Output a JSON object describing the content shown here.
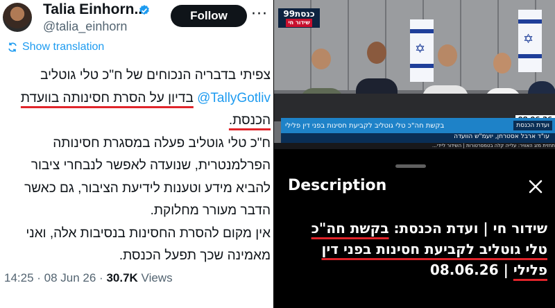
{
  "tweet": {
    "author_name": "Talia Einhorn...",
    "handle": "@talia_einhorn",
    "follow_label": "Follow",
    "more_glyph": "···",
    "show_translation": "Show translation",
    "p1_a": "צפיתי בדבריה הנכוחים של ח\"כ טלי גוטליב ",
    "mention": "@TallyGotliv",
    "p1_b": " ",
    "p1_ul": "בדיון על הסרת חסינותה בוועדת הכנסת.",
    "p2": "ח\"כ טלי גוטליב פעלה במסגרת חסינותה הפרלמנטרית, שנועדה לאפשר לנבחרי ציבור להביא מידע וטענות לידיעת הציבור, גם כאשר הדבר מעורר מחלוקת.",
    "p3": "אין מקום להסרת החסינות בנסיבות אלה, ואני מאמינה שכך תפעל הכנסת.",
    "time": "14:25 · 08 Jun 26 · ",
    "views_count": "30.7K",
    "views_label": " Views"
  },
  "video": {
    "logo_text": "כנסת99",
    "logo_sub": "שידור חי",
    "ticker_tag": "ועדת הכנסת",
    "ticker_main": "בקשת חה\"כ טלי גוטליב לקביעת חסינות בפני דין פלילי",
    "ticker_sub": "עו\"ד ארבל אסטרחן, יועמ\"ש הוועדה",
    "date": "08.06.26",
    "ticker_bottom": "תחזית מזג האוויר: עלייה קלה בטמפרטורות | השידור ליידי..."
  },
  "description": {
    "title": "Description",
    "line1_a": "שידור חי | ועדת הכנסת: ",
    "line1_ul": "בקשת חה\"כ",
    "line2_ul": "טלי גוטליב לקביעת חסינות בפני דין",
    "line3_ul": "פלילי",
    "line3_b": " | ",
    "date": "08.06.26"
  },
  "colors": {
    "link": "#1d9bf0",
    "underline": "#e0242a",
    "text": "#0f1419",
    "muted": "#536471",
    "verified": "#1d9bf0"
  }
}
